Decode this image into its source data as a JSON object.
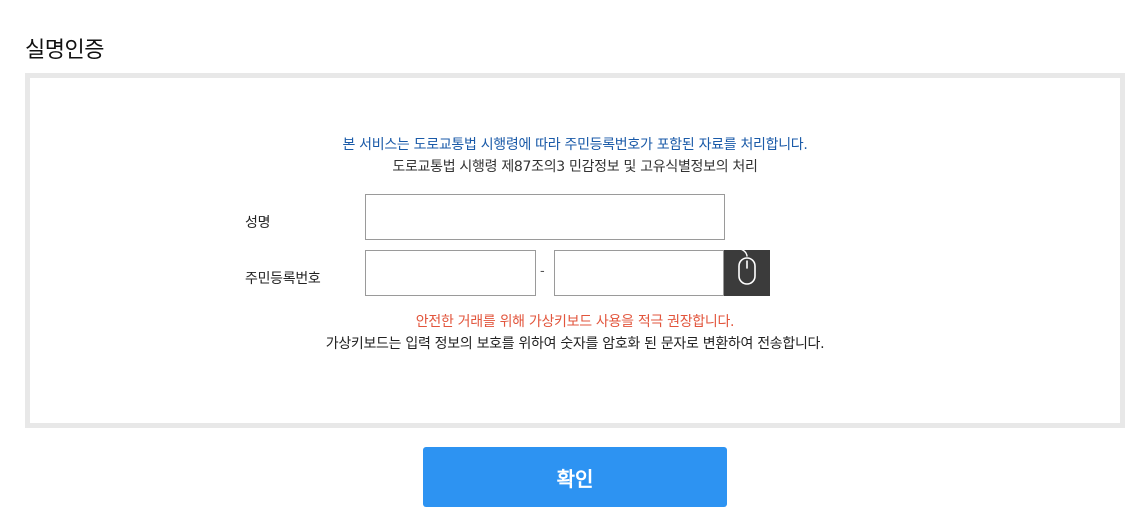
{
  "page": {
    "title": "실명인증"
  },
  "notice": {
    "main": "본 서비스는 도로교통법 시행령에 따라 주민등록번호가 포함된 자료를 처리합니다.",
    "sub": "도로교통법 시행령 제87조의3 민감정보 및 고유식별정보의 처리"
  },
  "form": {
    "name_label": "성명",
    "name_value": "",
    "rrn_label": "주민등록번호",
    "rrn_front_value": "",
    "rrn_back_value": "",
    "rrn_separator": "-",
    "keypad_icon": "mouse-icon"
  },
  "warning": {
    "main": "안전한 거래를 위해 가상키보드 사용을 적극 권장합니다.",
    "sub": "가상키보드는 입력 정보의 보호를 위하여 숫자를 암호화 된 문자로 변환하여 전송합니다."
  },
  "actions": {
    "confirm_label": "확인"
  },
  "colors": {
    "notice_text": "#1a5aa8",
    "warning_text": "#e2553c",
    "confirm_bg": "#2d93f2",
    "keypad_bg": "#3b3b3b",
    "panel_border": "#e8e8e8"
  }
}
